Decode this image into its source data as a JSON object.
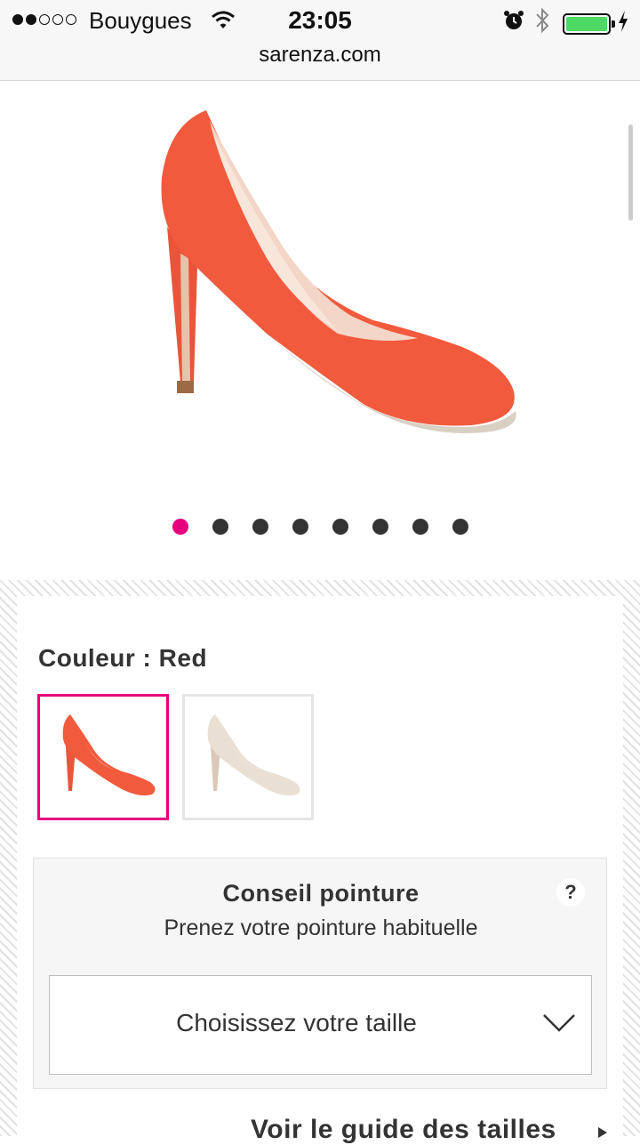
{
  "status_bar": {
    "carrier": "Bouygues",
    "time": "23:05",
    "url": "sarenza.com",
    "icons": [
      "signal-dots-icon",
      "wifi-icon",
      "alarm-icon",
      "bluetooth-icon",
      "battery-icon",
      "charging-bolt-icon"
    ]
  },
  "product": {
    "carousel_count": 8,
    "active_index": 0,
    "accent_color": "#e6007e",
    "shoe_color": "#f25a3d"
  },
  "color_picker": {
    "label": "Couleur : Red",
    "options": [
      {
        "name": "Red",
        "selected": true
      },
      {
        "name": "Beige",
        "selected": false
      }
    ]
  },
  "size_advice": {
    "title": "Conseil pointure",
    "subtitle": "Prenez votre pointure habituelle",
    "help_label": "?"
  },
  "size_select": {
    "placeholder": "Choisissez votre taille"
  },
  "size_guide_link": "Voir le guide des tailles"
}
